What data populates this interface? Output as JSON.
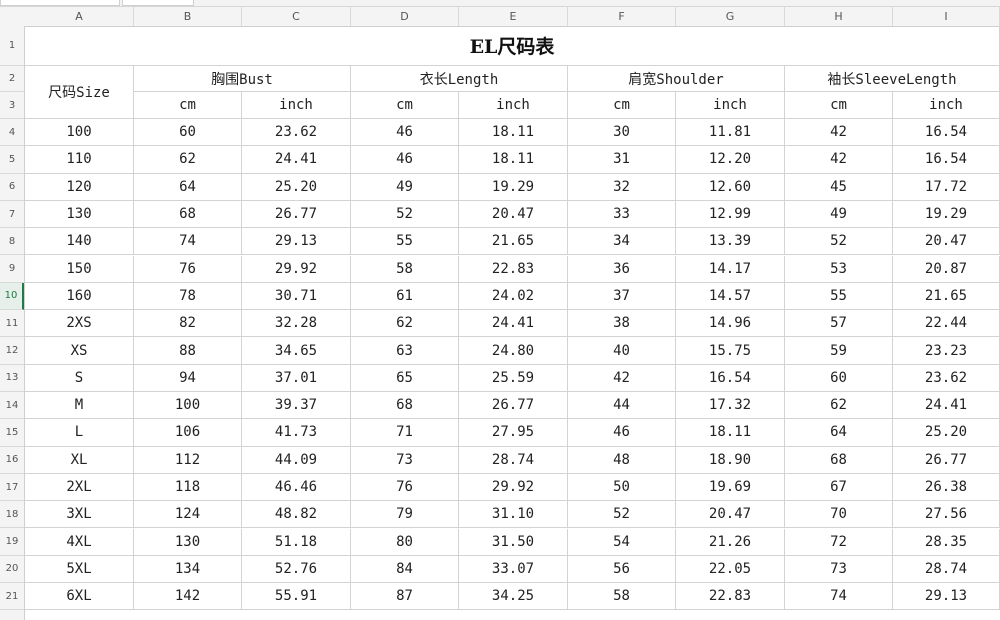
{
  "sheet": {
    "columns": [
      "A",
      "B",
      "C",
      "D",
      "E",
      "F",
      "G",
      "H",
      "I"
    ],
    "selected_row": 10,
    "title": "EL尺码表",
    "size_header": "尺码Size",
    "groups": [
      "胸围Bust",
      "衣长Length",
      "肩宽Shoulder",
      "袖长SleeveLength"
    ],
    "units": [
      "cm",
      "inch",
      "cm",
      "inch",
      "cm",
      "inch",
      "cm",
      "inch"
    ],
    "rows": [
      [
        "100",
        "60",
        "23.62",
        "46",
        "18.11",
        "30",
        "11.81",
        "42",
        "16.54"
      ],
      [
        "110",
        "62",
        "24.41",
        "46",
        "18.11",
        "31",
        "12.20",
        "42",
        "16.54"
      ],
      [
        "120",
        "64",
        "25.20",
        "49",
        "19.29",
        "32",
        "12.60",
        "45",
        "17.72"
      ],
      [
        "130",
        "68",
        "26.77",
        "52",
        "20.47",
        "33",
        "12.99",
        "49",
        "19.29"
      ],
      [
        "140",
        "74",
        "29.13",
        "55",
        "21.65",
        "34",
        "13.39",
        "52",
        "20.47"
      ],
      [
        "150",
        "76",
        "29.92",
        "58",
        "22.83",
        "36",
        "14.17",
        "53",
        "20.87"
      ],
      [
        "160",
        "78",
        "30.71",
        "61",
        "24.02",
        "37",
        "14.57",
        "55",
        "21.65"
      ],
      [
        "2XS",
        "82",
        "32.28",
        "62",
        "24.41",
        "38",
        "14.96",
        "57",
        "22.44"
      ],
      [
        "XS",
        "88",
        "34.65",
        "63",
        "24.80",
        "40",
        "15.75",
        "59",
        "23.23"
      ],
      [
        "S",
        "94",
        "37.01",
        "65",
        "25.59",
        "42",
        "16.54",
        "60",
        "23.62"
      ],
      [
        "M",
        "100",
        "39.37",
        "68",
        "26.77",
        "44",
        "17.32",
        "62",
        "24.41"
      ],
      [
        "L",
        "106",
        "41.73",
        "71",
        "27.95",
        "46",
        "18.11",
        "64",
        "25.20"
      ],
      [
        "XL",
        "112",
        "44.09",
        "73",
        "28.74",
        "48",
        "18.90",
        "68",
        "26.77"
      ],
      [
        "2XL",
        "118",
        "46.46",
        "76",
        "29.92",
        "50",
        "19.69",
        "67",
        "26.38"
      ],
      [
        "3XL",
        "124",
        "48.82",
        "79",
        "31.10",
        "52",
        "20.47",
        "70",
        "27.56"
      ],
      [
        "4XL",
        "130",
        "51.18",
        "80",
        "31.50",
        "54",
        "21.26",
        "72",
        "28.35"
      ],
      [
        "5XL",
        "134",
        "52.76",
        "84",
        "33.07",
        "56",
        "22.05",
        "73",
        "28.74"
      ],
      [
        "6XL",
        "142",
        "55.91",
        "87",
        "34.25",
        "58",
        "22.83",
        "74",
        "29.13"
      ]
    ]
  }
}
